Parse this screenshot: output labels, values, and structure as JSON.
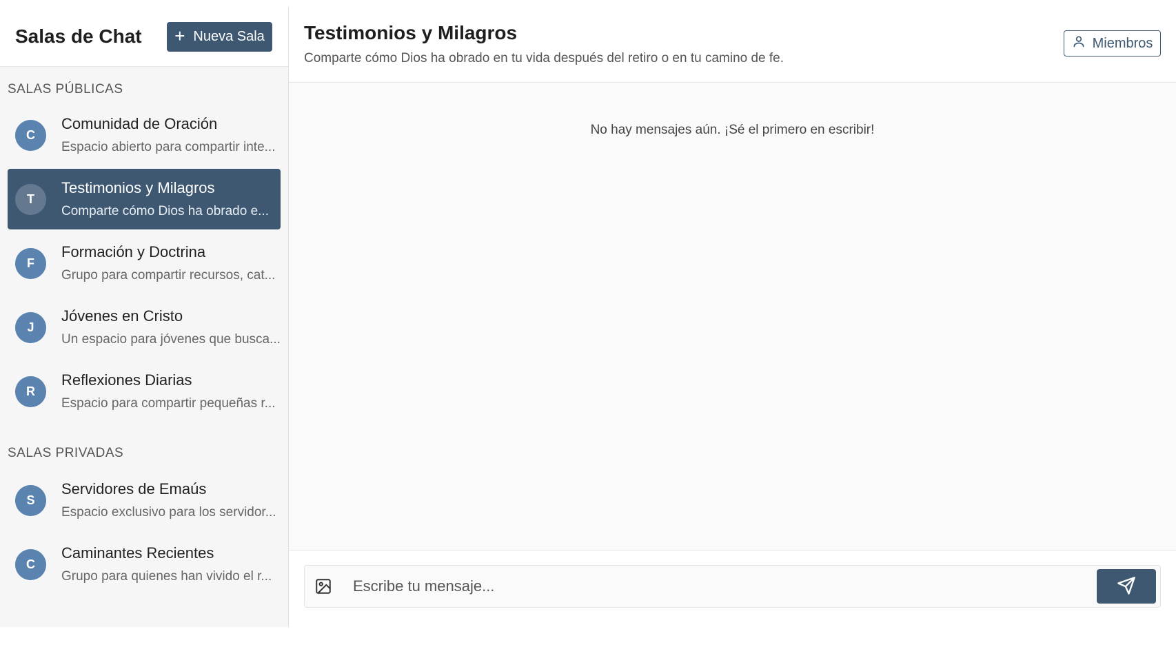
{
  "sidebar": {
    "title": "Salas de Chat",
    "new_room_label": "Nueva Sala",
    "public_section_label": "SALAS PÚBLICAS",
    "private_section_label": "SALAS PRIVADAS",
    "public_rooms": [
      {
        "initial": "C",
        "name": "Comunidad de Oración",
        "desc": "Espacio abierto para compartir inte..."
      },
      {
        "initial": "T",
        "name": "Testimonios y Milagros",
        "desc": "Comparte cómo Dios ha obrado e...",
        "active": true
      },
      {
        "initial": "F",
        "name": "Formación y Doctrina",
        "desc": "Grupo para compartir recursos, cat..."
      },
      {
        "initial": "J",
        "name": "Jóvenes en Cristo",
        "desc": "Un espacio para jóvenes que busca..."
      },
      {
        "initial": "R",
        "name": "Reflexiones Diarias",
        "desc": "Espacio para compartir pequeñas r..."
      }
    ],
    "private_rooms": [
      {
        "initial": "S",
        "name": "Servidores de Emaús",
        "desc": "Espacio exclusivo para los servidor..."
      },
      {
        "initial": "C",
        "name": "Caminantes Recientes",
        "desc": "Grupo para quienes han vivido el r..."
      }
    ]
  },
  "chat": {
    "title": "Testimonios y Milagros",
    "subtitle": "Comparte cómo Dios ha obrado en tu vida después del retiro o en tu camino de fe.",
    "members_label": "Miembros",
    "empty_text": "No hay mensajes aún. ¡Sé el primero en escribir!",
    "input_placeholder": "Escribe tu mensaje..."
  },
  "icons": {
    "new_room": "plus-icon",
    "members": "user-icon",
    "attach": "image-icon",
    "send": "send-icon"
  },
  "colors": {
    "accent": "#3e5872",
    "avatar": "#5a83b0"
  }
}
